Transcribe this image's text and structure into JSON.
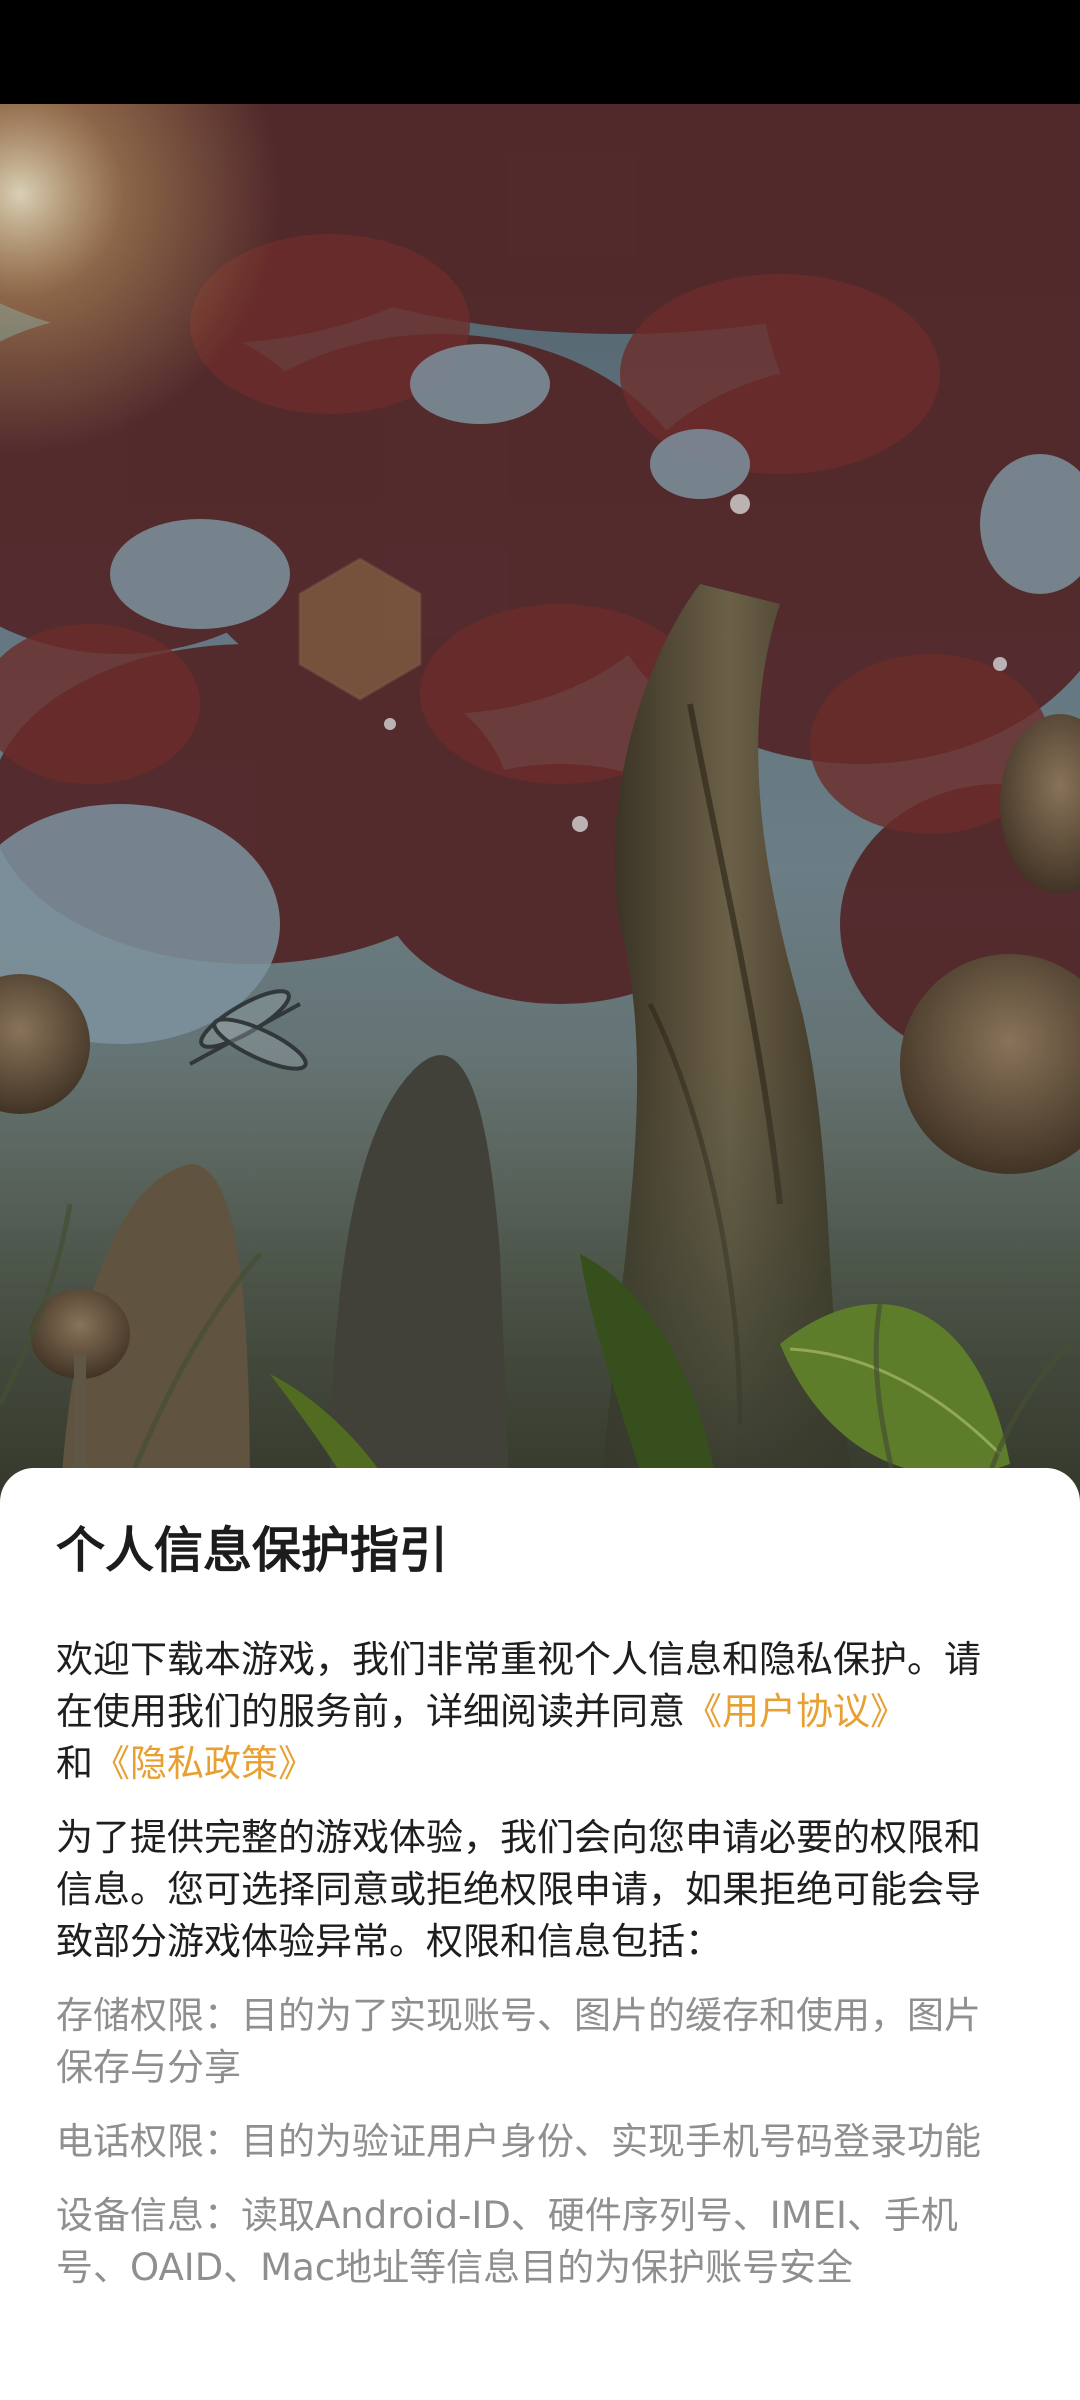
{
  "sheet": {
    "title": "个人信息保护指引",
    "intro_text": "欢迎下载本游戏，我们非常重视个人信息和隐私保护。请在使用我们的服务前，详细阅读并同意",
    "user_agreement_link": "《用户协议》",
    "and_text": "和",
    "privacy_policy_link": "《隐私政策》",
    "permissions_intro": "为了提供完整的游戏体验，我们会向您申请必要的权限和信息。您可选择同意或拒绝权限申请，如果拒绝可能会导致部分游戏体验异常。权限和信息包括：",
    "permissions": [
      "存储权限：目的为了实现账号、图片的缓存和使用，图片保存与分享",
      "电话权限：目的为验证用户身份、实现手机号码登录功能",
      "设备信息：读取Android-ID、硬件序列号、IMEI、手机号、OAID、Mac地址等信息目的为保护账号安全"
    ]
  },
  "colors": {
    "link": "#e8a033",
    "title": "#1c1c1c",
    "body_text": "#1e1e1e",
    "muted_text": "#8f8f8f",
    "sheet_background": "#ffffff"
  },
  "background_image": {
    "icon_name": "fantasy-forest-tree-artwork"
  }
}
